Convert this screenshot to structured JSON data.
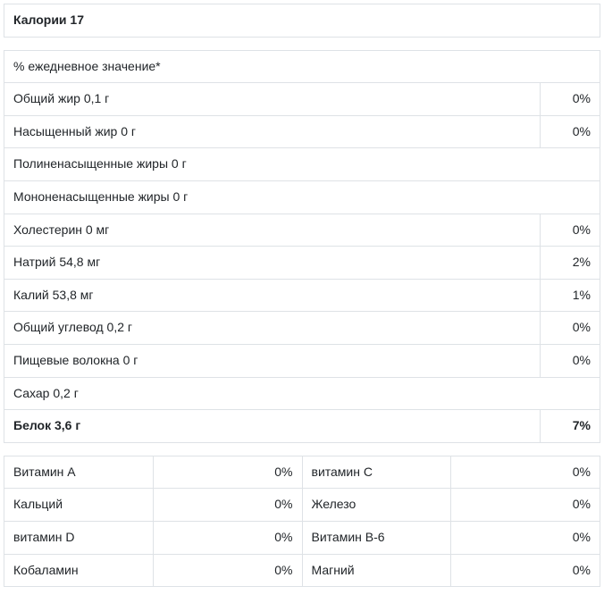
{
  "header": {
    "calories": "Калории 17"
  },
  "main": {
    "dv_header": "% ежедневное значение*",
    "rows": [
      {
        "label": "Общий жир 0,1 г",
        "value": "0%"
      },
      {
        "label": "Насыщенный жир 0 г",
        "value": "0%"
      },
      {
        "label": "Полиненасыщенные жиры 0 г",
        "value": ""
      },
      {
        "label": "Мононенасыщенные жиры 0 г",
        "value": ""
      },
      {
        "label": "Холестерин 0 мг",
        "value": "0%"
      },
      {
        "label": "Натрий 54,8 мг",
        "value": "2%"
      },
      {
        "label": "Калий 53,8 мг",
        "value": "1%"
      },
      {
        "label": "Общий углевод 0,2 г",
        "value": "0%"
      },
      {
        "label": "Пищевые волокна 0 г",
        "value": "0%"
      },
      {
        "label": "Сахар 0,2 г",
        "value": ""
      }
    ],
    "protein": {
      "label": "Белок 3,6 г",
      "value": "7%"
    }
  },
  "vitamins": [
    {
      "l1": "Витамин A",
      "v1": "0%",
      "l2": "витамин C",
      "v2": "0%"
    },
    {
      "l1": "Кальций",
      "v1": "0%",
      "l2": "Железо",
      "v2": "0%"
    },
    {
      "l1": "витамин D",
      "v1": "0%",
      "l2": "Витамин B-6",
      "v2": "0%"
    },
    {
      "l1": "Кобаламин",
      "v1": "0%",
      "l2": "Магний",
      "v2": "0%"
    }
  ]
}
